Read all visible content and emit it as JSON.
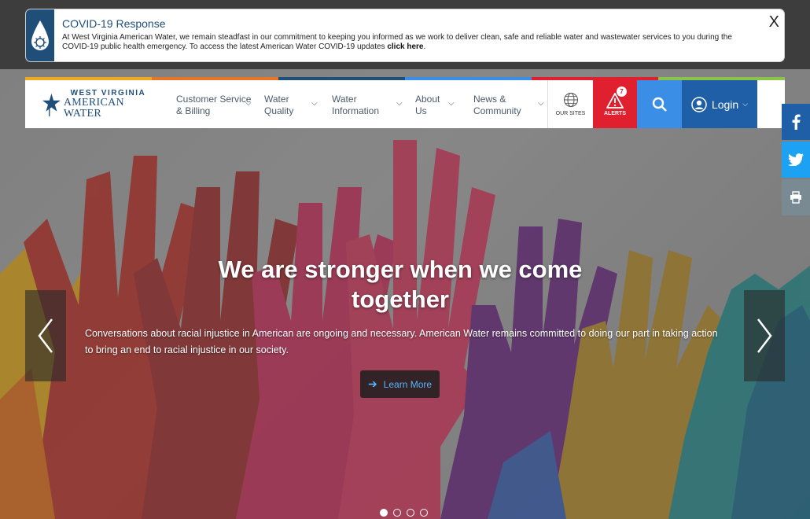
{
  "covid": {
    "title": "COVID-19 Response",
    "text": "At West Virginia American Water, we remain steadfast in our commitment to keeping you informed as we work to deliver clean, safe and reliable water and wastewater services to you during the COVID-19 public health emergency. To access the latest American Water COVID-19 updates",
    "link": "click here",
    "link_suffix": ".",
    "close": "X"
  },
  "logo": {
    "top": "WEST VIRGINIA",
    "bottom": "AMERICAN WATER"
  },
  "nav": {
    "items": [
      {
        "label": "Customer Service & Billing"
      },
      {
        "label": "Water Quality"
      },
      {
        "label": "Water Information"
      },
      {
        "label": "About Us"
      },
      {
        "label": "News & Community"
      }
    ],
    "our_sites": "OUR SITES",
    "alerts": "ALERTS",
    "alerts_count": "7",
    "login": "Login"
  },
  "slide": {
    "headline": "We are stronger when we come together",
    "subtext": "Conversations about racial injustice in American are ongoing and necessary. American Water remains committed to doing our part in taking action to bring an end to racial injustice in our society.",
    "button": "Learn More",
    "active_index": 0,
    "count": 4
  },
  "colors": {
    "brand_navy": "#1f4e79",
    "alert_red": "#e0202f",
    "search_blue": "#3a8ee6",
    "login_blue": "#1f5fa8",
    "topbar": [
      "#f2a81d",
      "#e8742a",
      "#1f4e79",
      "#3a8ee6",
      "#e0202f",
      "#8bc34a"
    ]
  }
}
